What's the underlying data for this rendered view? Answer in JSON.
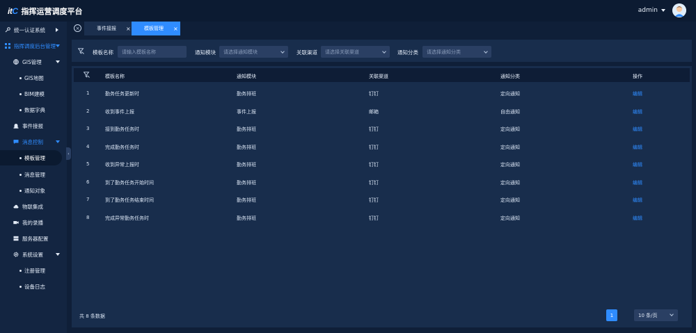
{
  "app": {
    "logo_prefix": "it",
    "logo_suffix": "C",
    "title": "指挥运营调度平台"
  },
  "user": {
    "name": "admin"
  },
  "sidebar": {
    "items": [
      {
        "label": "统一认证系统",
        "icon": "key-icon"
      },
      {
        "label": "指挥调度后台管理",
        "icon": "grid-icon"
      },
      {
        "label": "GIS管理",
        "icon": "globe-icon"
      },
      {
        "label": "GIS地图"
      },
      {
        "label": "BIM建模"
      },
      {
        "label": "数据字典"
      },
      {
        "label": "事件接报",
        "icon": "alarm-icon"
      },
      {
        "label": "消息控制",
        "icon": "message-icon"
      },
      {
        "label": "模板管理"
      },
      {
        "label": "消息管理"
      },
      {
        "label": "通知对象"
      },
      {
        "label": "物联集成",
        "icon": "cloud-icon"
      },
      {
        "label": "我的录播",
        "icon": "video-icon"
      },
      {
        "label": "服务器配置",
        "icon": "server-icon"
      },
      {
        "label": "系统设置",
        "icon": "gear-icon"
      },
      {
        "label": "注册管理"
      },
      {
        "label": "设备日志"
      }
    ]
  },
  "tabs": [
    {
      "label": "事件接报",
      "close": "×"
    },
    {
      "label": "模板管理",
      "close": "×"
    }
  ],
  "filters": {
    "name_label": "模板名称",
    "name_placeholder": "请输入模板名称",
    "module_label": "通知模块",
    "module_placeholder": "请选择通知模块",
    "channel_label": "关联渠道",
    "channel_placeholder": "请选择关联渠道",
    "category_label": "通知分类",
    "category_placeholder": "请选择通知分类"
  },
  "table": {
    "headers": [
      "模板名称",
      "通知模块",
      "关联渠道",
      "通知分类",
      "操作"
    ],
    "rows": [
      {
        "no": "1",
        "name": "勤务任务更新时",
        "module": "勤务排班",
        "channel": "钉钉",
        "category": "定向通知",
        "action": "编辑"
      },
      {
        "no": "2",
        "name": "收到事件上报",
        "module": "事件上报",
        "channel": "邮箱",
        "category": "自由通知",
        "action": "编辑"
      },
      {
        "no": "3",
        "name": "接到勤务任务时",
        "module": "勤务排班",
        "channel": "钉钉",
        "category": "定向通知",
        "action": "编辑"
      },
      {
        "no": "4",
        "name": "完成勤务任务时",
        "module": "勤务排班",
        "channel": "钉钉",
        "category": "定向通知",
        "action": "编辑"
      },
      {
        "no": "5",
        "name": "收到异常上报时",
        "module": "勤务排班",
        "channel": "钉钉",
        "category": "定向通知",
        "action": "编辑"
      },
      {
        "no": "6",
        "name": "到了勤务任务开始时间",
        "module": "勤务排班",
        "channel": "钉钉",
        "category": "定向通知",
        "action": "编辑"
      },
      {
        "no": "7",
        "name": "到了勤务任务结束时间",
        "module": "勤务排班",
        "channel": "钉钉",
        "category": "定向通知",
        "action": "编辑"
      },
      {
        "no": "8",
        "name": "完成异常勤务任务时",
        "module": "勤务排班",
        "channel": "钉钉",
        "category": "定向通知",
        "action": "编辑"
      }
    ]
  },
  "pagination": {
    "total": "共 8 条数据",
    "current": "1",
    "page_size": "10 条/页"
  },
  "colors": {
    "accent": "#2f8cff",
    "background": "#0f1f38",
    "panel": "#182d4c",
    "sidebar": "#132541"
  }
}
